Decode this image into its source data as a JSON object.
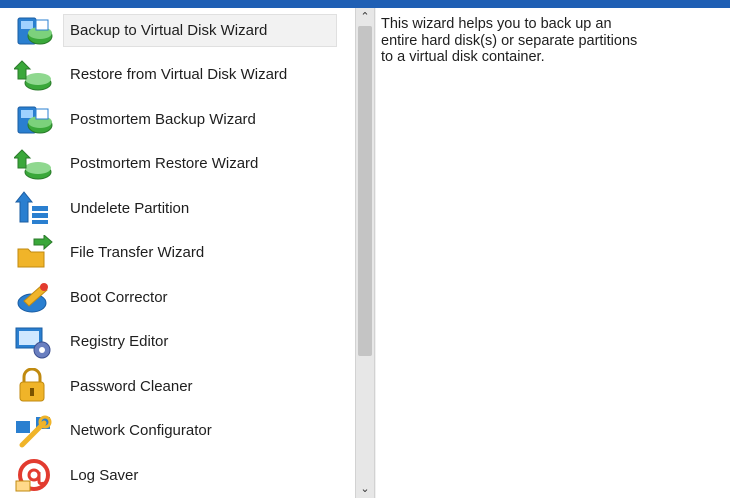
{
  "wizards": [
    {
      "label": "Backup to Virtual Disk Wizard",
      "icon": "backup-disk-icon",
      "selected": true
    },
    {
      "label": "Restore from Virtual Disk Wizard",
      "icon": "restore-disk-icon"
    },
    {
      "label": "Postmortem Backup Wizard",
      "icon": "postmortem-backup-icon"
    },
    {
      "label": "Postmortem Restore Wizard",
      "icon": "postmortem-restore-icon"
    },
    {
      "label": "Undelete Partition",
      "icon": "undelete-partition-icon"
    },
    {
      "label": "File Transfer Wizard",
      "icon": "folder-transfer-icon"
    },
    {
      "label": "Boot Corrector",
      "icon": "boot-corrector-icon"
    },
    {
      "label": "Registry Editor",
      "icon": "registry-gear-icon"
    },
    {
      "label": "Password Cleaner",
      "icon": "padlock-icon"
    },
    {
      "label": "Network Configurator",
      "icon": "network-wrench-icon"
    },
    {
      "label": "Log Saver",
      "icon": "log-email-icon"
    }
  ],
  "description": {
    "lines": [
      "This wizard helps you to back up an",
      "entire hard disk(s) or separate partitions",
      "to a virtual disk container."
    ]
  },
  "colors": {
    "title_bar": "#1f5fb4",
    "selection_bg": "#f2f2f2",
    "icon_blue": "#2a7fd0",
    "icon_green": "#3aa83a",
    "icon_yellow": "#f0b429",
    "icon_red": "#e23b2f"
  }
}
